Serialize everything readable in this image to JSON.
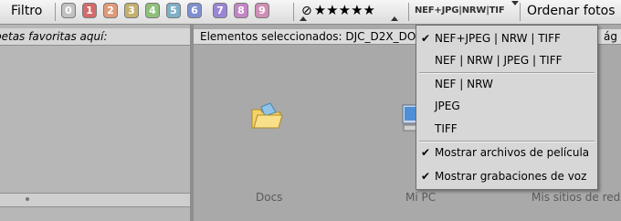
{
  "toolbar": {
    "filter_label": "Filtro",
    "label_chips": [
      {
        "text": "0",
        "color": "#c2c2c2"
      },
      {
        "text": "1",
        "color": "#d46a6a"
      },
      {
        "text": "2",
        "color": "#e09a7a"
      },
      {
        "text": "3",
        "color": "#c4b070"
      },
      {
        "text": "4",
        "color": "#8fc07a"
      },
      {
        "text": "5",
        "color": "#7fb0c8"
      },
      {
        "text": "6",
        "color": "#7f90d0"
      },
      {
        "text": "7",
        "color": "#9a86d6"
      },
      {
        "text": "8",
        "color": "#c486c6"
      },
      {
        "text": "9",
        "color": "#cf8fb4"
      }
    ],
    "no_rating_symbol": "⊘",
    "stars": "★★★★★",
    "format_filter_label": "NEF+JPG|NRW|TIF",
    "sort_label": "Ordenar fotos"
  },
  "left_panel": {
    "header_text": "petas favoritas aquí:"
  },
  "content": {
    "header_text": "Elementos seleccionados: DJC_D2X_DOR",
    "header_right_text": "ág",
    "items": [
      {
        "label": "Docs"
      },
      {
        "label": "Mi PC"
      },
      {
        "label": "Mis sitios de red"
      }
    ]
  },
  "format_menu": {
    "items": [
      {
        "label": "NEF+JPEG | NRW | TIFF",
        "checked": true
      },
      {
        "label": "NEF | NRW | JPEG | TIFF",
        "checked": false
      },
      {
        "label": "NEF | NRW",
        "checked": false
      },
      {
        "label": "JPEG",
        "checked": false
      },
      {
        "label": "TIFF",
        "checked": false
      },
      {
        "label": "Mostrar archivos de película",
        "checked": true
      },
      {
        "label": "Mostrar grabaciones de voz",
        "checked": true
      }
    ],
    "check_glyph": "✔"
  }
}
